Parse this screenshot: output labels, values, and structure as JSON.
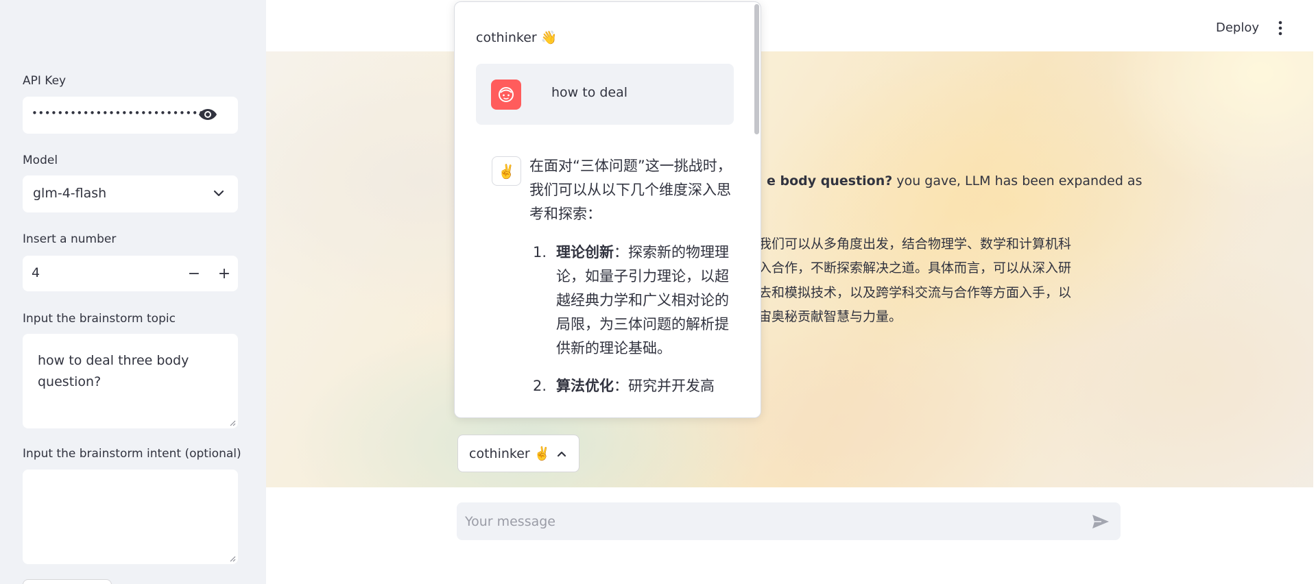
{
  "sidebar": {
    "api_key_label": "API Key",
    "api_key_value": "••••••••••••••••••••••••••••••••••",
    "model_label": "Model",
    "model_value": "glm-4-flash",
    "number_label": "Insert a number",
    "number_value": "4",
    "number_minus": "−",
    "number_plus": "+",
    "topic_label": "Input the brainstorm topic",
    "topic_value": "how to deal three body question?",
    "intent_label": "Input the brainstorm intent (optional)",
    "intent_value": ""
  },
  "header": {
    "deploy_label": "Deploy"
  },
  "main": {
    "expand_bold": "e body question?",
    "expand_rest": " you gave, LLM has been expanded as",
    "expanded_lines": [
      "我们可以从多角度出发，结合物理学、数学和计算机科",
      "入合作，不断探索解决之道。具体而言，可以从深入研",
      "去和模拟技术，以及跨学科交流与合作等方面入手，以",
      "宙奥秘贡献智慧与力量。"
    ]
  },
  "popover": {
    "title": "cothinker 👋",
    "user_message": "how to deal",
    "bot_avatar": "✌️",
    "bot_intro": "在面对“三体问题”这一挑战时，我们可以从以下几个维度深入思考和探索：",
    "items": [
      {
        "num": "1.",
        "title": "理论创新",
        "text": "：探索新的物理理论，如量子引力理论，以超越经典力学和广义相对论的局限，为三体问题的解析提供新的理论基础。"
      },
      {
        "num": "2.",
        "title": "算法优化",
        "text": "：研究并开发高"
      }
    ]
  },
  "trigger": {
    "label": "cothinker ✌️"
  },
  "chat": {
    "placeholder": "Your message"
  }
}
